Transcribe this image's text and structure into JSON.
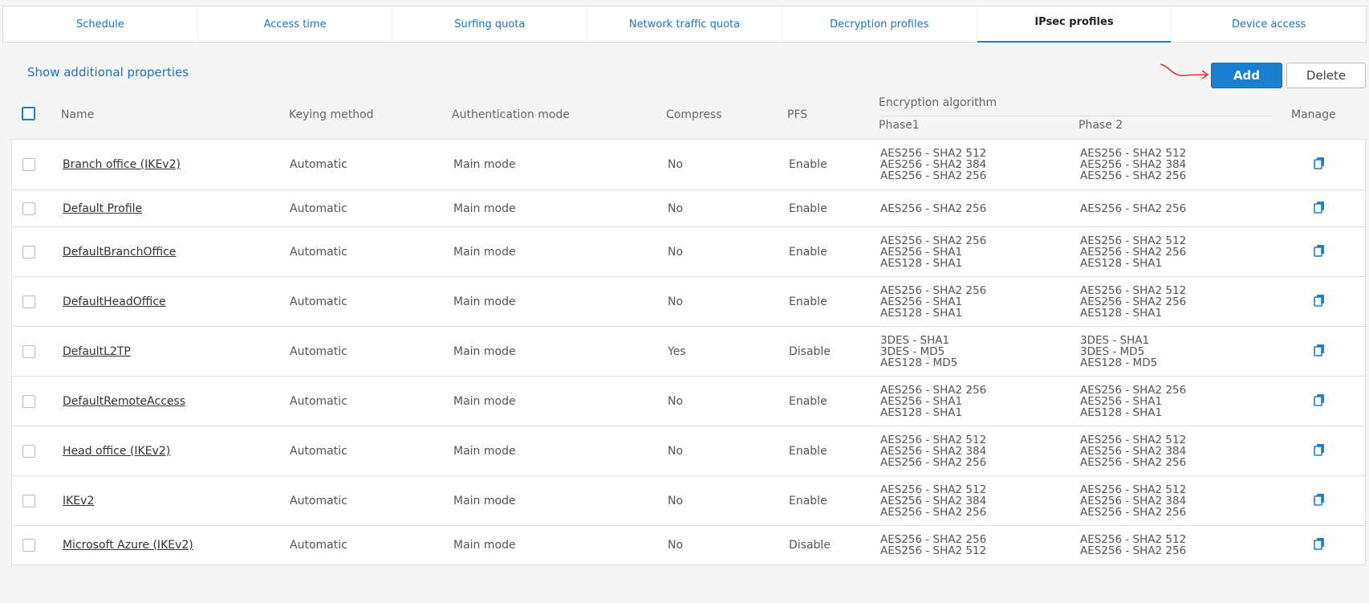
{
  "tabs": [
    {
      "label": "Schedule",
      "active": false
    },
    {
      "label": "Access time",
      "active": false
    },
    {
      "label": "Surfing quota",
      "active": false
    },
    {
      "label": "Network traffic quota",
      "active": false
    },
    {
      "label": "Decryption profiles",
      "active": false
    },
    {
      "label": "IPsec profiles",
      "active": true
    },
    {
      "label": "Device access",
      "active": false
    }
  ],
  "toolbar": {
    "show_props": "Show additional properties",
    "add_label": "Add",
    "delete_label": "Delete"
  },
  "columns": {
    "name": "Name",
    "keying": "Keying method",
    "auth": "Authentication mode",
    "compress": "Compress",
    "pfs": "PFS",
    "encryption": "Encryption algorithm",
    "phase1": "Phase1",
    "phase2": "Phase 2",
    "manage": "Manage"
  },
  "rows": [
    {
      "name": "Branch office (IKEv2)",
      "keying": "Automatic",
      "auth": "Main mode",
      "compress": "No",
      "pfs": "Enable",
      "phase1": [
        "AES256 - SHA2 512",
        "AES256 - SHA2 384",
        "AES256 - SHA2 256"
      ],
      "phase2": [
        "AES256 - SHA2 512",
        "AES256 - SHA2 384",
        "AES256 - SHA2 256"
      ]
    },
    {
      "name": "Default Profile",
      "keying": "Automatic",
      "auth": "Main mode",
      "compress": "No",
      "pfs": "Enable",
      "phase1": [
        "AES256 - SHA2 256"
      ],
      "phase2": [
        "AES256 - SHA2 256"
      ]
    },
    {
      "name": "DefaultBranchOffice",
      "keying": "Automatic",
      "auth": "Main mode",
      "compress": "No",
      "pfs": "Enable",
      "phase1": [
        "AES256 - SHA2 256",
        "AES256 - SHA1",
        "AES128 - SHA1"
      ],
      "phase2": [
        "AES256 - SHA2 512",
        "AES256 - SHA2 256",
        "AES128 - SHA1"
      ]
    },
    {
      "name": "DefaultHeadOffice",
      "keying": "Automatic",
      "auth": "Main mode",
      "compress": "No",
      "pfs": "Enable",
      "phase1": [
        "AES256 - SHA2 256",
        "AES256 - SHA1",
        "AES128 - SHA1"
      ],
      "phase2": [
        "AES256 - SHA2 512",
        "AES256 - SHA2 256",
        "AES128 - SHA1"
      ]
    },
    {
      "name": "DefaultL2TP",
      "keying": "Automatic",
      "auth": "Main mode",
      "compress": "Yes",
      "pfs": "Disable",
      "phase1": [
        "3DES - SHA1",
        "3DES - MD5",
        "AES128 - MD5"
      ],
      "phase2": [
        "3DES - SHA1",
        "3DES - MD5",
        "AES128 - MD5"
      ]
    },
    {
      "name": "DefaultRemoteAccess",
      "keying": "Automatic",
      "auth": "Main mode",
      "compress": "No",
      "pfs": "Enable",
      "phase1": [
        "AES256 - SHA2 256",
        "AES256 - SHA1",
        "AES128 - SHA1"
      ],
      "phase2": [
        "AES256 - SHA2 256",
        "AES256 - SHA1",
        "AES128 - SHA1"
      ]
    },
    {
      "name": "Head office (IKEv2)",
      "keying": "Automatic",
      "auth": "Main mode",
      "compress": "No",
      "pfs": "Enable",
      "phase1": [
        "AES256 - SHA2 512",
        "AES256 - SHA2 384",
        "AES256 - SHA2 256"
      ],
      "phase2": [
        "AES256 - SHA2 512",
        "AES256 - SHA2 384",
        "AES256 - SHA2 256"
      ]
    },
    {
      "name": "IKEv2",
      "keying": "Automatic",
      "auth": "Main mode",
      "compress": "No",
      "pfs": "Enable",
      "phase1": [
        "AES256 - SHA2 512",
        "AES256 - SHA2 384",
        "AES256 - SHA2 256"
      ],
      "phase2": [
        "AES256 - SHA2 512",
        "AES256 - SHA2 384",
        "AES256 - SHA2 256"
      ]
    },
    {
      "name": "Microsoft Azure (IKEv2)",
      "keying": "Automatic",
      "auth": "Main mode",
      "compress": "No",
      "pfs": "Disable",
      "phase1": [
        "AES256 - SHA2 256",
        "AES256 - SHA2 512"
      ],
      "phase2": [
        "AES256 - SHA2 512",
        "AES256 - SHA2 256"
      ]
    }
  ],
  "icons": {
    "manage": "copy-icon",
    "annotation": "red-arrow-annotation"
  },
  "colors": {
    "accent": "#1b7fd1",
    "link": "#1b74c5",
    "annotation": "#e53030"
  }
}
